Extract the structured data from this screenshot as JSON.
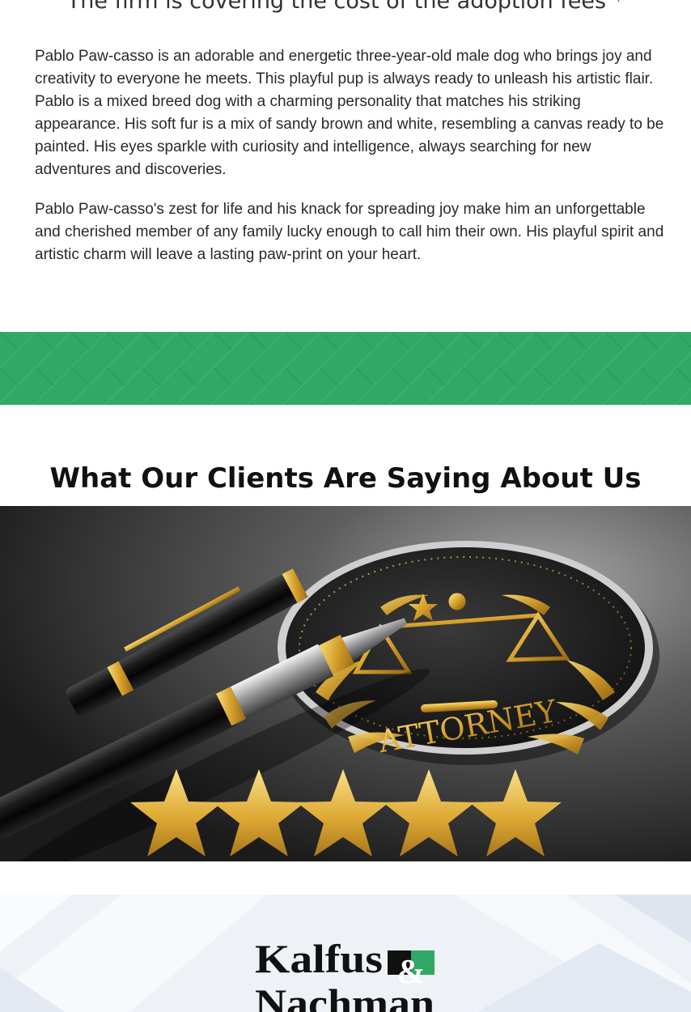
{
  "fee_notice": {
    "text": "The firm is covering the cost of the adoption fees",
    "asterisk": "*"
  },
  "pet_bio": {
    "paragraphs": [
      "Pablo Paw-casso is an adorable and energetic three-year-old male dog who brings joy and creativity to everyone he meets. This playful pup is always ready to unleash his artistic flair. Pablo is a mixed breed dog with a charming personality that matches his striking appearance. His soft fur is a mix of sandy brown and white, resembling a canvas ready to be painted. His eyes sparkle with curiosity and intelligence, always searching for new adventures and discoveries.",
      "Pablo Paw-casso's zest for life and his knack for spreading joy make him an unforgettable and cherished member of any family lucky enough to call him their own. His playful spirit and artistic charm will leave a lasting paw-print on your heart."
    ]
  },
  "testimonials": {
    "title": "What Our Clients Are Saying About Us",
    "image": {
      "seal_text": "ATTORNEY",
      "rating": 5,
      "rating_max": 5,
      "icons": [
        "fountain-pen-icon",
        "scales-of-justice-icon",
        "star-icon"
      ]
    }
  },
  "footer": {
    "logo": {
      "line1": "Kalfus",
      "ampersand": "&",
      "line2": "Nachman"
    }
  },
  "colors": {
    "brand_green": "#30a866",
    "gold": "#e0b23a",
    "heading_text": "#111111",
    "body_text": "#2a2a2a"
  }
}
